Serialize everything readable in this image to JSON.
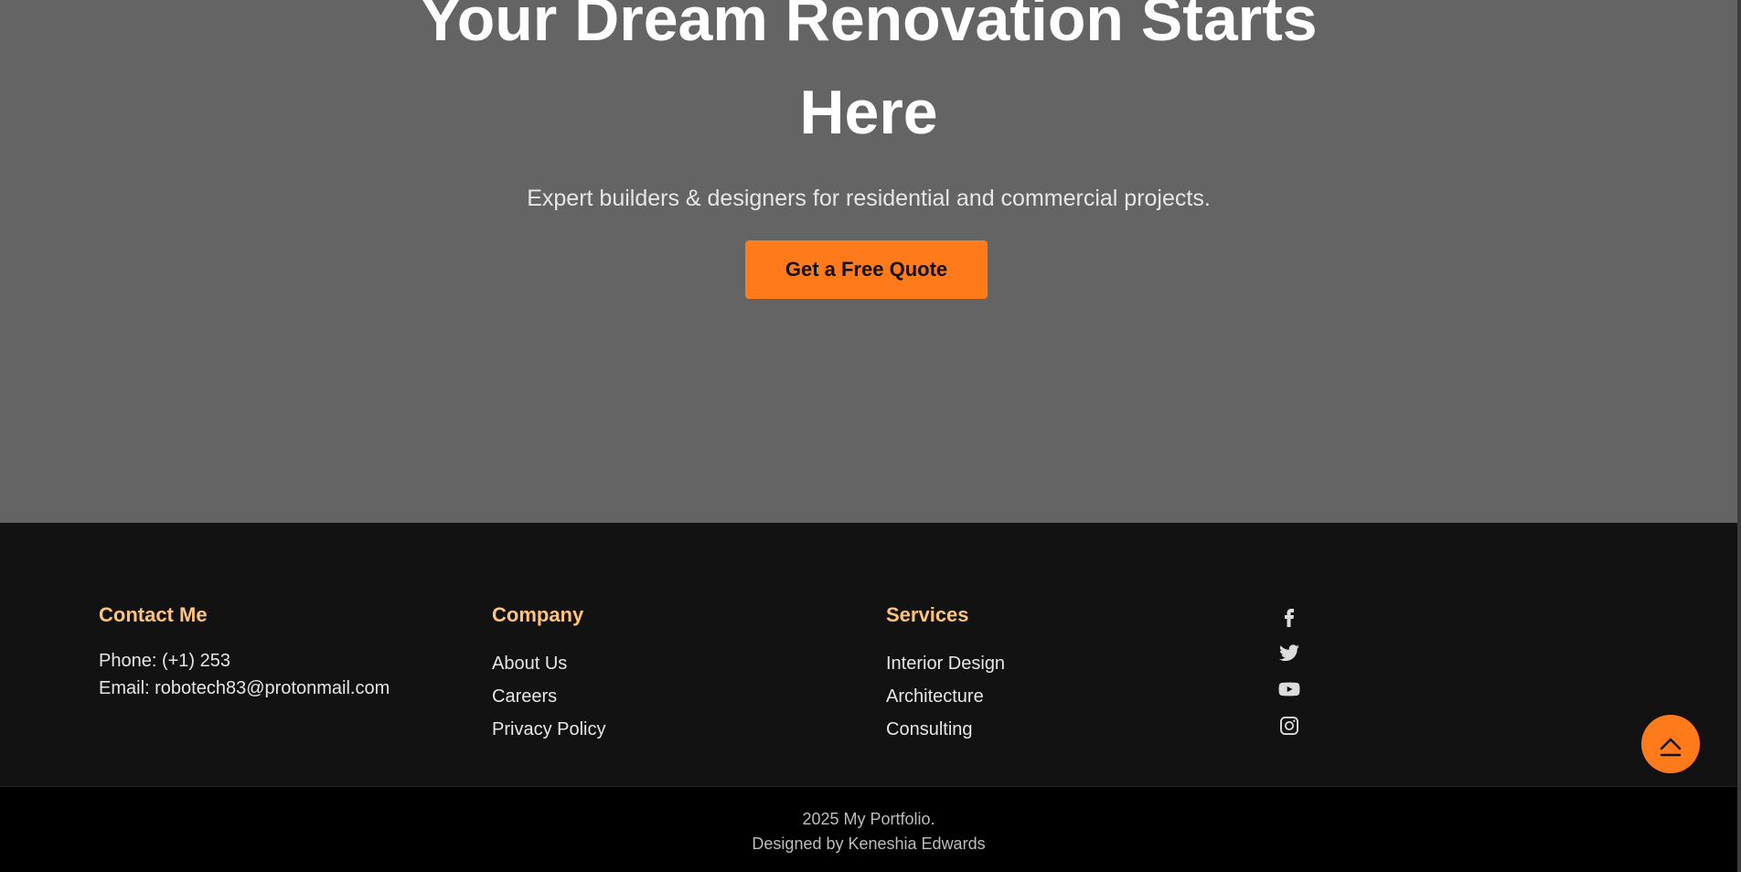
{
  "hero": {
    "title": "Your Dream Renovation Starts Here",
    "subtitle": "Expert builders & designers for residential and commercial projects.",
    "cta_label": "Get a Free Quote"
  },
  "footer": {
    "contact": {
      "heading": "Contact Me",
      "phone": "Phone: (+1) 253",
      "email": "Email: robotech83@protonmail.com"
    },
    "company": {
      "heading": "Company",
      "links": [
        "About Us",
        "Careers",
        "Privacy Policy"
      ]
    },
    "services": {
      "heading": "Services",
      "links": [
        "Interior Design",
        "Architecture",
        "Consulting"
      ]
    },
    "social": {
      "icons": [
        "facebook-icon",
        "twitter-icon",
        "youtube-icon",
        "instagram-icon"
      ]
    }
  },
  "bottom": {
    "copyright": "2025 My Portfolio.",
    "credit": "Designed by Keneshia Edwards"
  },
  "colors": {
    "hero_bg": "#646464",
    "accent": "#ff7a1a",
    "footer_bg": "#121212",
    "heading": "#ffc478",
    "bottom_bg": "#000000"
  }
}
